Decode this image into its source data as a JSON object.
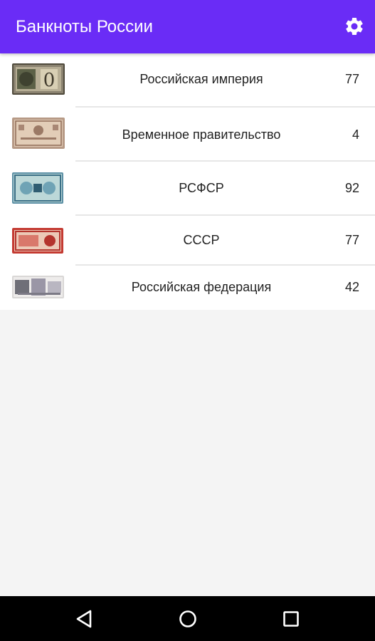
{
  "app_bar": {
    "title": "Банкноты России",
    "background": "#6a2cf6",
    "settings_icon": "gear-icon"
  },
  "categories": [
    {
      "label": "Российская империя",
      "count": "77",
      "thumb": "banknote-image-empire"
    },
    {
      "label": "Временное правительство",
      "count": "4",
      "thumb": "banknote-image-provisional"
    },
    {
      "label": "РСФСР",
      "count": "92",
      "thumb": "banknote-image-rsfsr"
    },
    {
      "label": "СССР",
      "count": "77",
      "thumb": "banknote-image-ussr"
    },
    {
      "label": "Российская федерация",
      "count": "42",
      "thumb": "banknote-image-federation"
    }
  ],
  "nav_bar": {
    "back_icon": "back-triangle-icon",
    "home_icon": "home-circle-icon",
    "recents_icon": "recents-square-icon"
  }
}
